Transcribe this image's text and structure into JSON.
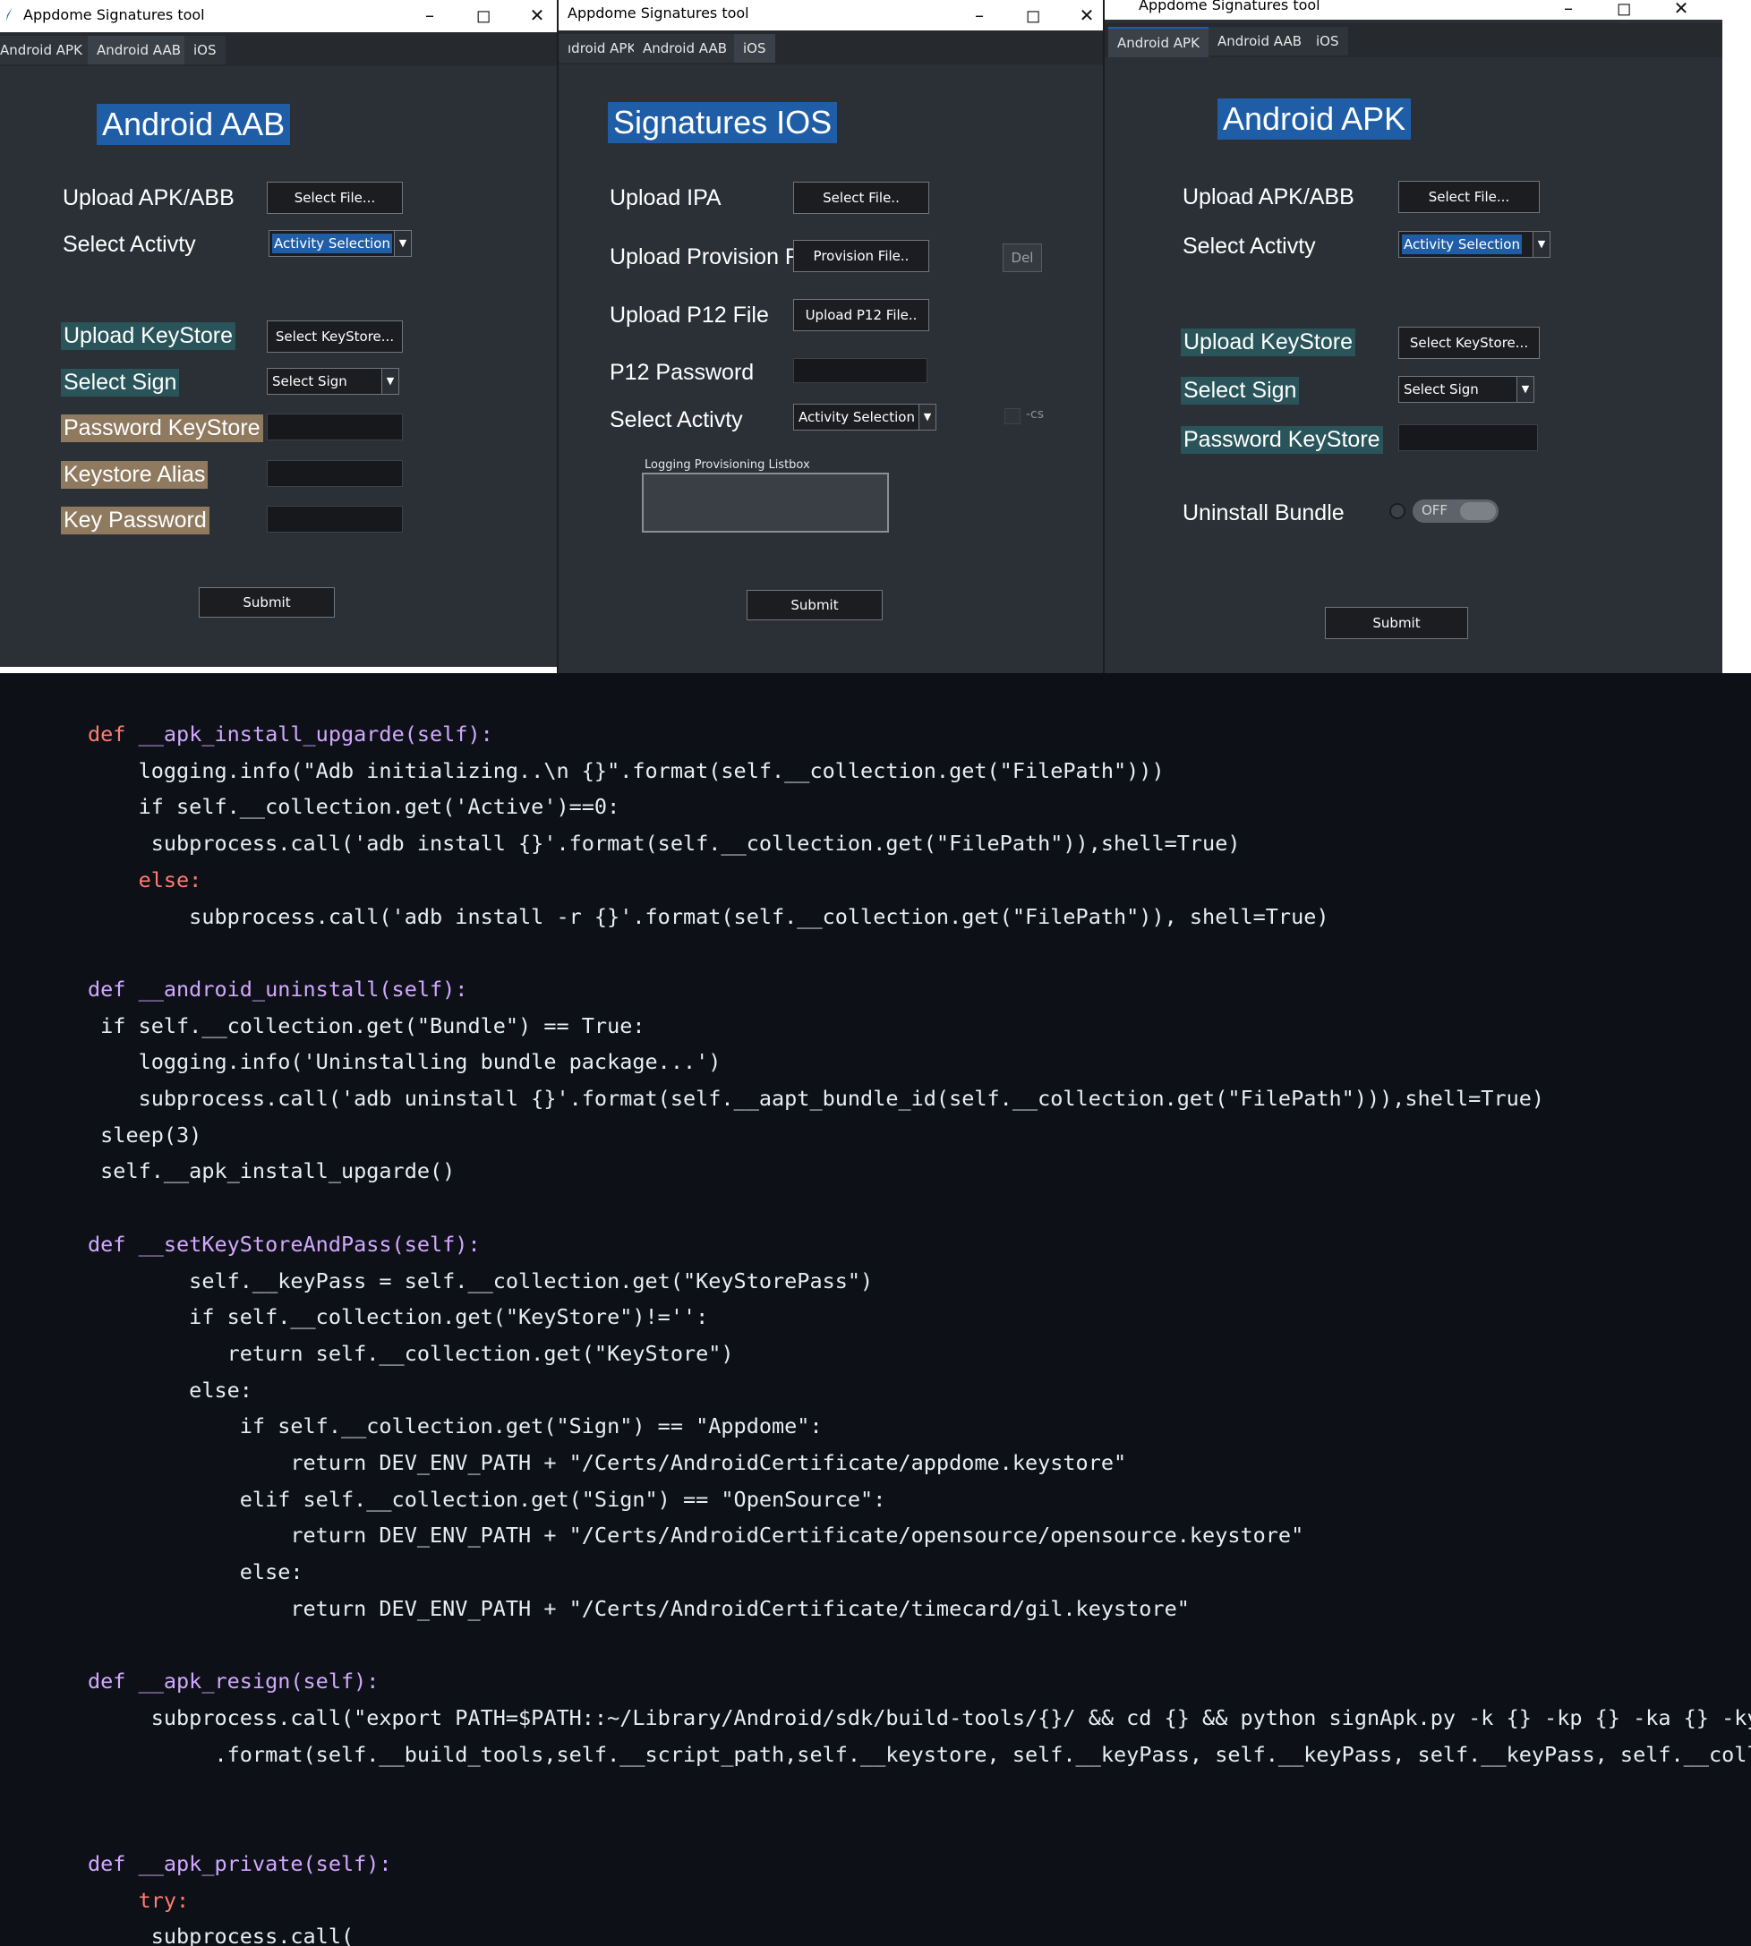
{
  "window_title": "Appdome Signatures tool",
  "tabs": [
    "Android APK",
    "Android AAB",
    "iOS"
  ],
  "aab": {
    "heading": "Android AAB",
    "upload_label": "Upload APK/ABB",
    "select_file": "Select File...",
    "select_activity_label": "Select Activty",
    "activity_selection": "Activity Selection",
    "upload_keystore_label": "Upload KeyStore",
    "select_keystore": "Select KeyStore...",
    "select_sign_label": "Select Sign",
    "select_sign_value": "Select Sign",
    "password_keystore_label": "Password KeyStore",
    "keystore_alias_label": "Keystore Alias",
    "key_password_label": "Key Password",
    "submit": "Submit"
  },
  "ios": {
    "heading": "Signatures IOS",
    "tab_apk_partial": "ıdroid APK",
    "upload_ipa_label": "Upload IPA",
    "select_file": "Select File..",
    "upload_provision_label": "Upload Provision F",
    "provision_file": "Provision File..",
    "del": "Del",
    "upload_p12_label": "Upload P12 File",
    "upload_p12_button": "Upload P12 File..",
    "p12_password_label": "P12 Password",
    "select_activity_label": "Select Activty",
    "activity_selection": "Activity Selection",
    "cs_label": "-cs",
    "logging_label": "Logging Provisioning Listbox",
    "submit": "Submit"
  },
  "apk": {
    "heading": "Android APK",
    "upload_label": "Upload APK/ABB",
    "select_file": "Select File...",
    "select_activity_label": "Select Activty",
    "activity_selection": "Activity Selection",
    "upload_keystore_label": "Upload KeyStore",
    "select_keystore": "Select KeyStore...",
    "select_sign_label": "Select Sign",
    "select_sign_value": "Select Sign",
    "password_keystore_label": "Password KeyStore",
    "uninstall_label": "Uninstall Bundle",
    "toggle_text": "OFF",
    "submit": "Submit"
  },
  "code": {
    "l1": "def __apk_install_upgarde(self):",
    "l2": "    logging.info(\"Adb initializing..\\n {}\".format(self.__collection.get(\"FilePath\")))",
    "l3": "    if self.__collection.get('Active')==0:",
    "l4": "     subprocess.call('adb install {}'.format(self.__collection.get(\"FilePath\")),shell=True)",
    "l5": "    else:",
    "l6": "        subprocess.call('adb install -r {}'.format(self.__collection.get(\"FilePath\")), shell=True)",
    "l7": "def __android_uninstall(self):",
    "l8": " if self.__collection.get(\"Bundle\") == True:",
    "l9": "    logging.info('Uninstalling bundle package...')",
    "l10": "    subprocess.call('adb uninstall {}'.format(self.__aapt_bundle_id(self.__collection.get(\"FilePath\"))),shell=True)",
    "l11": " sleep(3)",
    "l12": " self.__apk_install_upgarde()",
    "l13": "def __setKeyStoreAndPass(self):",
    "l14": "        self.__keyPass = self.__collection.get(\"KeyStorePass\")",
    "l15": "        if self.__collection.get(\"KeyStore\")!='':",
    "l16": "           return self.__collection.get(\"KeyStore\")",
    "l17": "        else:",
    "l18": "            if self.__collection.get(\"Sign\") == \"Appdome\":",
    "l19": "                return DEV_ENV_PATH + \"/Certs/AndroidCertificate/appdome.keystore\"",
    "l20": "            elif self.__collection.get(\"Sign\") == \"OpenSource\":",
    "l21": "                return DEV_ENV_PATH + \"/Certs/AndroidCertificate/opensource/opensource.keystore\"",
    "l22": "            else:",
    "l23": "                return DEV_ENV_PATH + \"/Certs/AndroidCertificate/timecard/gil.keystore\"",
    "l24": "def __apk_resign(self):",
    "l25": "     subprocess.call(\"export PATH=$PATH::~/Library/Android/sdk/build-tools/{}/ && cd {} && python signApk.py -k {} -kp {} -ka {} -kyp {} -c",
    "l26": "          .format(self.__build_tools,self.__script_path,self.__keystore, self.__keyPass, self.__keyPass, self.__keyPass, self.__colle",
    "l27": "def __apk_private(self):",
    "l28": "    try:",
    "l29": "     subprocess.call("
  }
}
